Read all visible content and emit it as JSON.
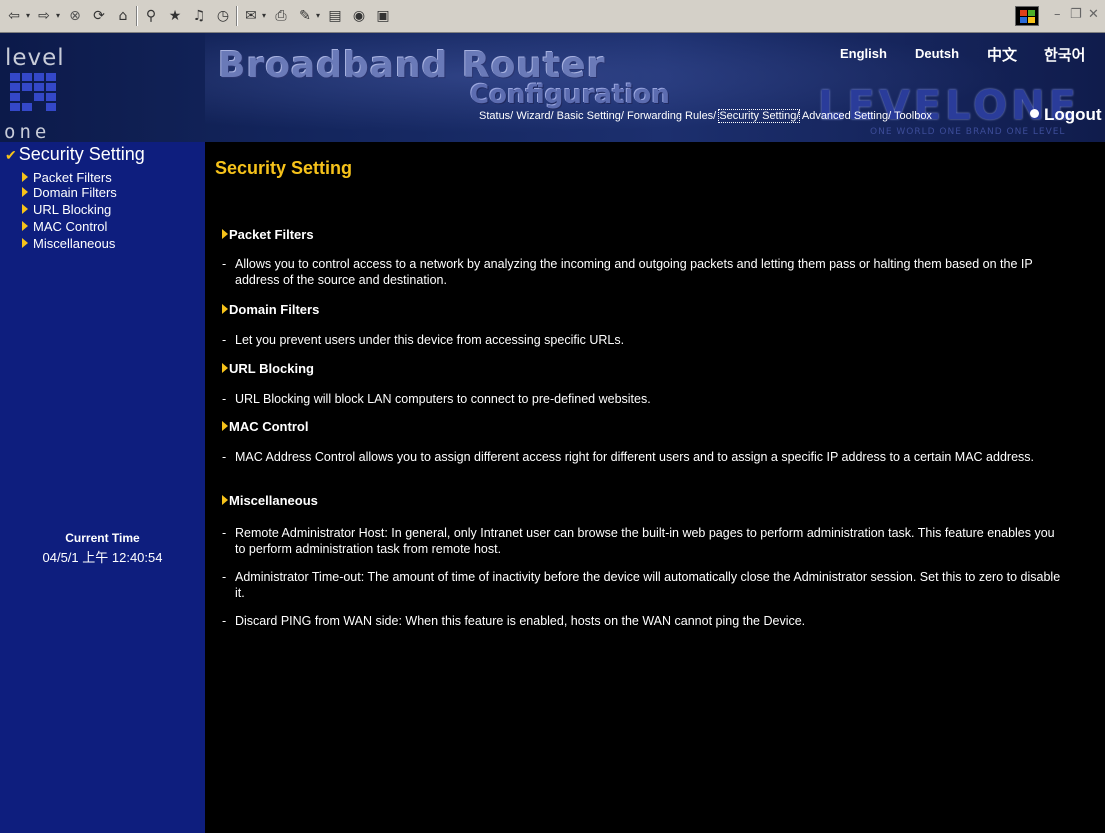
{
  "toolbar": {
    "buttons": [
      "back-icon",
      "forward-icon",
      "stop-icon",
      "refresh-icon",
      "home-icon",
      "search-icon",
      "favorites-icon",
      "media-icon",
      "history-icon",
      "mail-icon",
      "print-icon",
      "edit-icon",
      "discuss-icon",
      "messenger-icon",
      "research-icon"
    ]
  },
  "header": {
    "logo_level": "level",
    "logo_one": "one",
    "title_main": "Broadband Router",
    "title_sub": "Configuration",
    "brand": "LEVELONE",
    "slogan": "ONE WORLD  ONE BRAND  ONE LEVEL",
    "languages": [
      "English",
      "Deutsh",
      "中文",
      "한국어"
    ],
    "nav": [
      "Status/",
      "Wizard/",
      "Basic Setting/",
      "Forwarding Rules/",
      "Security Setting/",
      "Advanced Setting/",
      "Toolbox"
    ],
    "logout": "Logout"
  },
  "sidebar": {
    "title": "Security Setting",
    "items": [
      "Packet Filters",
      "Domain Filters",
      "URL Blocking",
      "MAC Control",
      "Miscellaneous"
    ],
    "time_label": "Current Time",
    "time_value": "04/5/1 上午 12:40:54"
  },
  "main": {
    "title": "Security Setting",
    "sections": [
      {
        "heading": "Packet Filters",
        "items": [
          "Allows you to control access to a network by analyzing the incoming and outgoing packets and letting them pass or halting them based on the IP address of the source and destination."
        ]
      },
      {
        "heading": "Domain Filters",
        "items": [
          "Let you prevent users under this device from accessing specific URLs."
        ]
      },
      {
        "heading": "URL Blocking",
        "items": [
          "URL Blocking will block LAN computers to connect to pre-defined websites."
        ]
      },
      {
        "heading": "MAC Control",
        "items": [
          "MAC Address Control allows you to assign different access right for different users and to assign a specific IP address to a certain MAC address."
        ]
      },
      {
        "heading": "Miscellaneous",
        "items": [
          "Remote Administrator Host: In general, only Intranet user can browse the built-in web pages to perform administration task. This feature enables you to perform administration task from remote host.",
          "Administrator Time-out: The amount of time of inactivity before the device will automatically close the Administrator session. Set this to zero to disable it.",
          "Discard PING from WAN side: When this feature is enabled, hosts on the WAN cannot ping the Device."
        ]
      }
    ]
  },
  "colors": {
    "sidebar_bg": "#0e1e7e",
    "main_bg": "#000000",
    "accent_yellow": "#f6c21a",
    "toolbar_bg": "#d4d0c8"
  }
}
